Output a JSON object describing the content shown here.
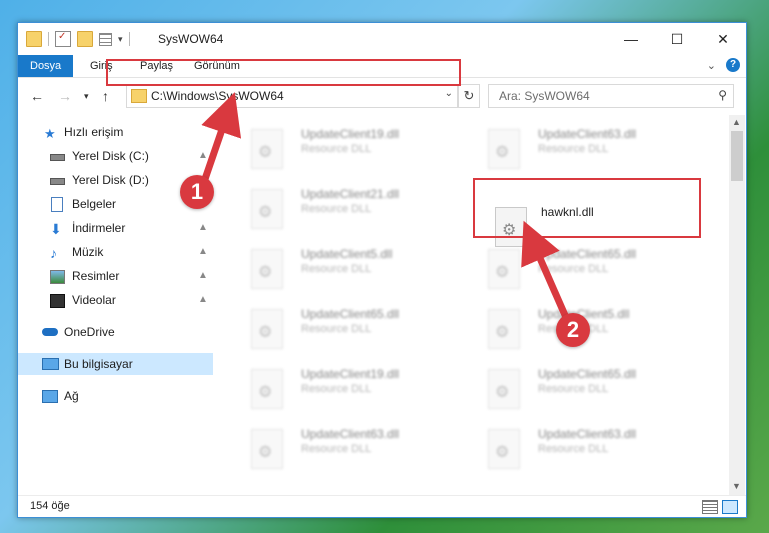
{
  "window": {
    "title": "SysWOW64"
  },
  "ribbon": {
    "tabs": [
      {
        "label": "Dosya",
        "active": true
      },
      {
        "label": "Giriş",
        "active": false
      },
      {
        "label": "Paylaş",
        "active": false
      },
      {
        "label": "Görünüm",
        "active": false
      }
    ]
  },
  "address": {
    "path": "C:\\Windows\\SysWOW64"
  },
  "search": {
    "placeholder": "Ara: SysWOW64"
  },
  "sidebar": {
    "items": [
      {
        "label": "Hızlı erişim",
        "icon": "star-icon",
        "pinned": false
      },
      {
        "label": "Yerel Disk (C:)",
        "icon": "drive-icon",
        "pinned": true
      },
      {
        "label": "Yerel Disk (D:)",
        "icon": "drive-icon",
        "pinned": true
      },
      {
        "label": "Belgeler",
        "icon": "document-icon",
        "pinned": true
      },
      {
        "label": "İndirmeler",
        "icon": "download-icon",
        "pinned": true
      },
      {
        "label": "Müzik",
        "icon": "music-icon",
        "pinned": true
      },
      {
        "label": "Resimler",
        "icon": "pictures-icon",
        "pinned": true
      },
      {
        "label": "Videolar",
        "icon": "video-icon",
        "pinned": true
      },
      {
        "label": "OneDrive",
        "icon": "cloud-icon",
        "pinned": false
      },
      {
        "label": "Bu bilgisayar",
        "icon": "computer-icon",
        "pinned": false,
        "selected": true
      },
      {
        "label": "Ağ",
        "icon": "network-icon",
        "pinned": false
      }
    ]
  },
  "files": [
    {
      "name": "UpdateClient19.dll",
      "type": "Resource DLL",
      "blurred": true
    },
    {
      "name": "UpdateClient63.dll",
      "type": "Resource DLL",
      "blurred": true
    },
    {
      "name": "UpdateClient21.dll",
      "type": "Resource DLL",
      "blurred": true
    },
    {
      "name": "hawknl.dll",
      "type": "",
      "blurred": false
    },
    {
      "name": "UpdateClient5.dll",
      "type": "Resource DLL",
      "blurred": true
    },
    {
      "name": "UpdateClient65.dll",
      "type": "Resource DLL",
      "blurred": true
    },
    {
      "name": "UpdateClient65.dll",
      "type": "Resource DLL",
      "blurred": true
    },
    {
      "name": "UpdateClient5.dll",
      "type": "Resource DLL",
      "blurred": true
    },
    {
      "name": "UpdateClient19.dll",
      "type": "Resource DLL",
      "blurred": true
    },
    {
      "name": "UpdateClient65.dll",
      "type": "Resource DLL",
      "blurred": true
    },
    {
      "name": "UpdateClient63.dll",
      "type": "Resource DLL",
      "blurred": true
    },
    {
      "name": "UpdateClient63.dll",
      "type": "Resource DLL",
      "blurred": true
    }
  ],
  "status": {
    "item_count": "154 öğe"
  },
  "callouts": {
    "one": "1",
    "two": "2"
  },
  "colors": {
    "accent": "#1979ca",
    "highlight": "#d9393f",
    "selected": "#cce8ff"
  }
}
